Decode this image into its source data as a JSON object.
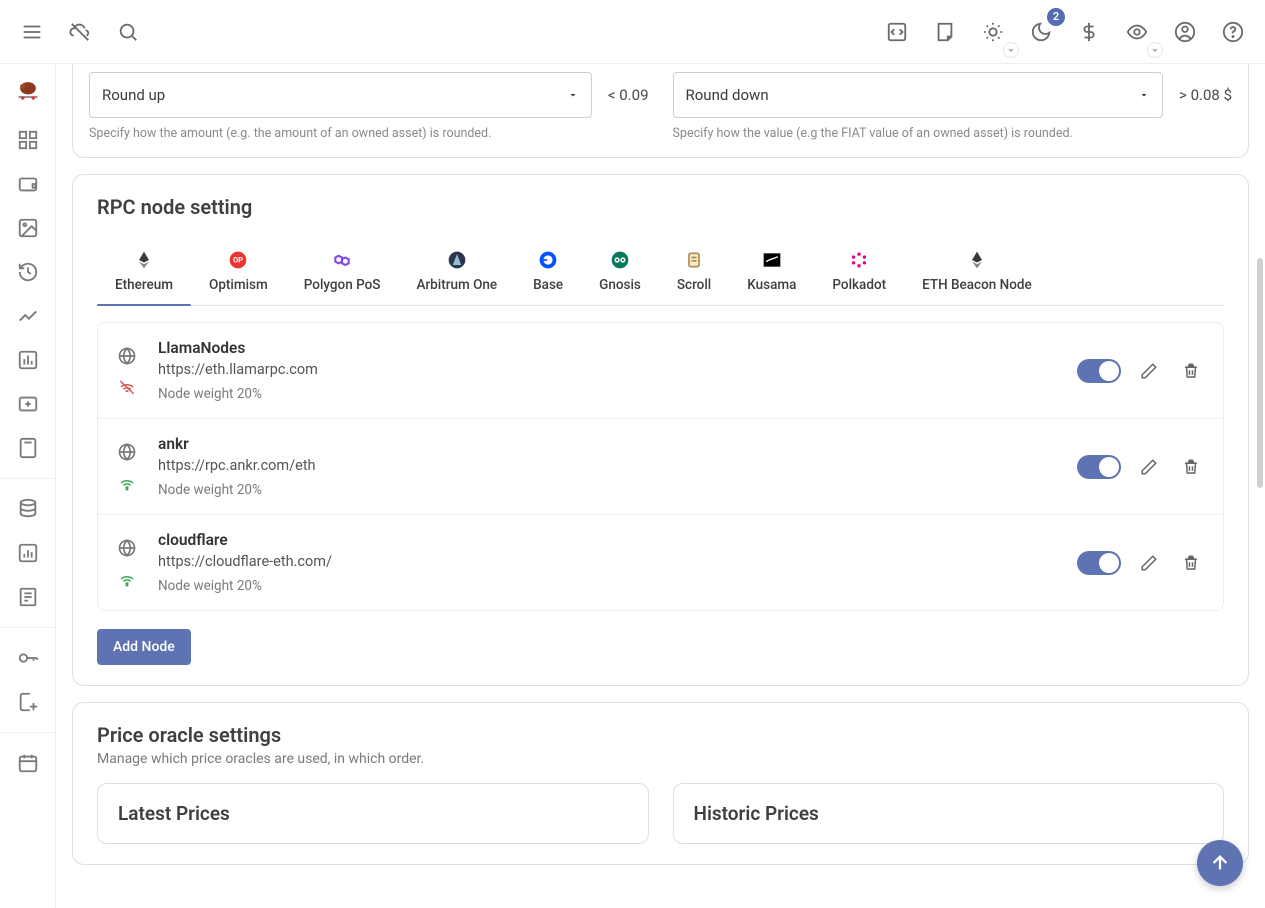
{
  "topbar": {
    "notifications_count": "2"
  },
  "rounding": {
    "amount": {
      "value": "Round up",
      "preview": "< 0.09",
      "helper": "Specify how the amount (e.g. the amount of an owned asset) is rounded."
    },
    "value": {
      "value": "Round down",
      "preview": "> 0.08 $",
      "helper": "Specify how the value (e.g the FIAT value of an owned asset) is rounded."
    }
  },
  "rpc": {
    "title": "RPC node setting",
    "add_label": "Add Node",
    "tabs": [
      {
        "label": "Ethereum"
      },
      {
        "label": "Optimism"
      },
      {
        "label": "Polygon PoS"
      },
      {
        "label": "Arbitrum One"
      },
      {
        "label": "Base"
      },
      {
        "label": "Gnosis"
      },
      {
        "label": "Scroll"
      },
      {
        "label": "Kusama"
      },
      {
        "label": "Polkadot"
      },
      {
        "label": "ETH Beacon Node"
      }
    ],
    "nodes": [
      {
        "name": "LlamaNodes",
        "url": "https://eth.llamarpc.com",
        "weight": "Node weight 20%",
        "online": false
      },
      {
        "name": "ankr",
        "url": "https://rpc.ankr.com/eth",
        "weight": "Node weight 20%",
        "online": true
      },
      {
        "name": "cloudflare",
        "url": "https://cloudflare-eth.com/",
        "weight": "Node weight 20%",
        "online": true
      }
    ]
  },
  "oracle": {
    "title": "Price oracle settings",
    "subtitle": "Manage which price oracles are used, in which order.",
    "latest_title": "Latest Prices",
    "historic_title": "Historic Prices"
  }
}
